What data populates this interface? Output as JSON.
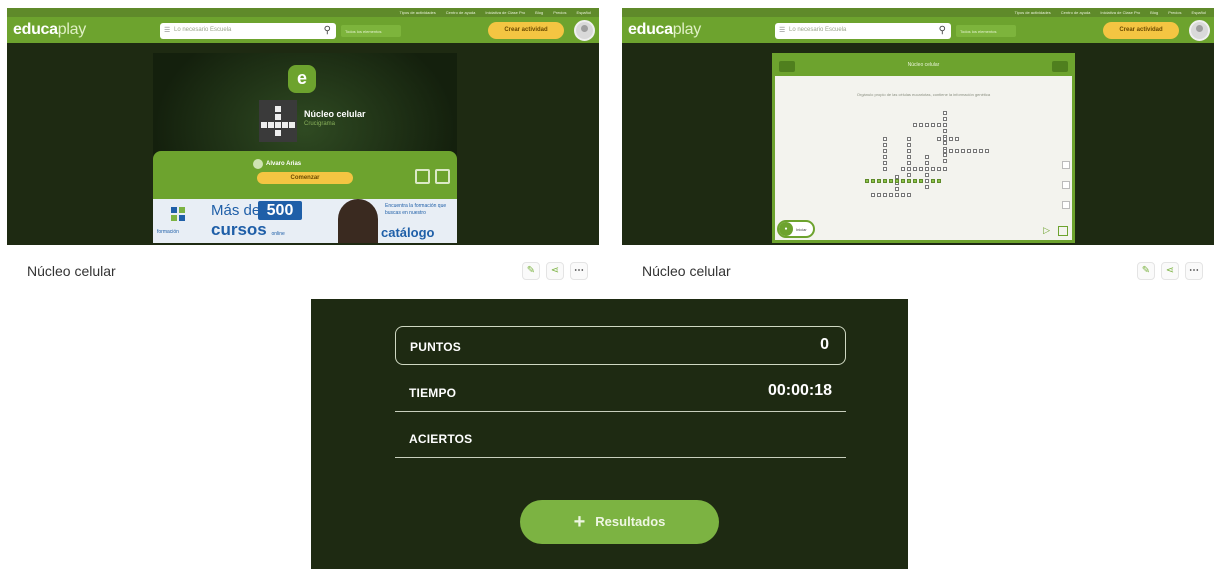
{
  "header": {
    "toplinks": [
      "Tipos de actividades",
      "Centro de ayuda",
      "Iniciativa de Clase Pro",
      "Blog",
      "Precios",
      "Español"
    ],
    "logo_main": "educa",
    "logo_lite": "play",
    "search_placeholder": "Lo necesario Escuela",
    "nav_mid": "Todos los elementos",
    "create_label": "Crear actividad"
  },
  "left_card": {
    "title": "Núcleo celular",
    "subtitle": "Crucigrama",
    "author": "Alvaro Arias",
    "start_label": "Comenzar",
    "ad": {
      "mas": "Más de",
      "number": "500",
      "cursos": "cursos",
      "online": "online",
      "encuentra": "Encuentra la formación que buscas en nuestro",
      "catalogo": "catálogo",
      "brand": "formación"
    }
  },
  "right_card": {
    "header_title": "Núcleo celular",
    "clue_text": "Orgánulo propio de las células eucariotas, contiene la información genética",
    "timer_label": "Iniciar"
  },
  "captions": {
    "left": "Núcleo celular",
    "right": "Núcleo celular"
  },
  "results": {
    "puntos_label": "PUNTOS",
    "puntos_value": "0",
    "tiempo_label": "TIEMPO",
    "tiempo_value": "00:00:18",
    "aciertos_label": "ACIERTOS",
    "aciertos_value": "",
    "button_label": "Resultados"
  },
  "colors": {
    "brand_green": "#6da32e",
    "dark_bg": "#1e2a12",
    "accent_yellow": "#f4c542"
  }
}
